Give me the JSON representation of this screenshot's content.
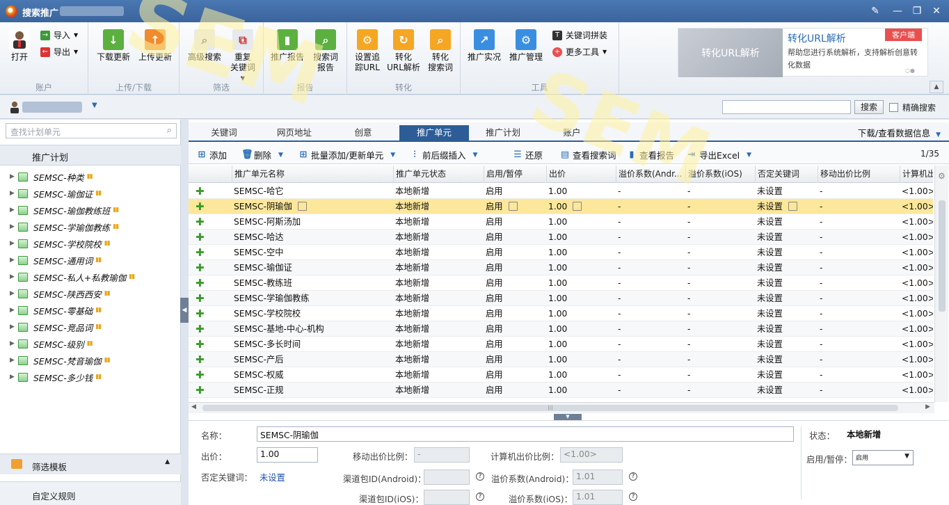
{
  "window": {
    "title": "搜索推广"
  },
  "ribbon": {
    "account_group": {
      "label": "账户",
      "open": "打开",
      "import": "导入",
      "export": "导出"
    },
    "transfer_group": {
      "label": "上传/下载",
      "download": "下载更新",
      "upload": "上传更新"
    },
    "filter_group": {
      "label": "筛选",
      "advanced": "高级搜索",
      "dup_line1": "重复",
      "dup_line2": "关键词"
    },
    "report_group": {
      "label": "报告",
      "promo_report": "推广报告",
      "sq_line1": "搜索词",
      "sq_line2": "报告"
    },
    "conv_group": {
      "label": "转化",
      "track_line1": "设置追",
      "track_line2": "踪URL",
      "url_line1": "转化",
      "url_line2": "URL解析",
      "sw_line1": "转化",
      "sw_line2": "搜索词"
    },
    "tool_group": {
      "label": "工具",
      "live": "推广实况",
      "manage": "推广管理",
      "kw_concat": "关键词拼装",
      "more": "更多工具"
    },
    "ad": {
      "image_text": "转化URL解析",
      "title": "转化URL解析",
      "desc": "帮助您进行系统解析，支持解析创意转化数据",
      "tag": "客户端"
    }
  },
  "topbar": {
    "search_button": "搜索",
    "exact": "精确搜索"
  },
  "left": {
    "search_placeholder": "查找计划单元",
    "header": "推广计划",
    "plans": [
      "SEMSC-种类",
      "SEMSC-瑜伽证",
      "SEMSC-瑜伽教练班",
      "SEMSC-学瑜伽教练",
      "SEMSC-学校院校",
      "SEMSC-通用词",
      "SEMSC-私人+私教瑜伽",
      "SEMSC-陕西西安",
      "SEMSC-零基础",
      "SEMSC-竞品词",
      "SEMSC-级别",
      "SEMSC-梵音瑜伽",
      "SEMSC-多少钱"
    ],
    "footer1": "筛选模板",
    "footer2": "自定义规则"
  },
  "tabs": [
    "关键词",
    "网页地址",
    "创意",
    "推广单元",
    "推广计划",
    "账户"
  ],
  "download_info": "下载/查看数据信息",
  "toolbar": {
    "add": "添加",
    "delete": "删除",
    "batch": "批量添加/更新单元",
    "insert": "前后缀插入",
    "restore": "还原",
    "view_sq": "查看搜索词",
    "view_report": "查看报告",
    "export": "导出Excel",
    "page": "1/35"
  },
  "grid": {
    "columns": [
      "推广单元名称",
      "推广单元状态",
      "启用/暂停",
      "出价",
      "溢价系数(Andr...",
      "溢价系数(iOS)",
      "否定关键词",
      "移动出价比例",
      "计算机出"
    ],
    "rows": [
      [
        "SEMSC-哈它",
        "本地新增",
        "启用",
        "1.00",
        "-",
        "-",
        "未设置",
        "-",
        "<1.00>"
      ],
      [
        "SEMSC-阴瑜伽",
        "本地新增",
        "启用",
        "1.00",
        "-",
        "-",
        "未设置",
        "-",
        "<1.00>"
      ],
      [
        "SEMSC-阿斯汤加",
        "本地新增",
        "启用",
        "1.00",
        "-",
        "-",
        "未设置",
        "-",
        "<1.00>"
      ],
      [
        "SEMSC-哈达",
        "本地新增",
        "启用",
        "1.00",
        "-",
        "-",
        "未设置",
        "-",
        "<1.00>"
      ],
      [
        "SEMSC-空中",
        "本地新增",
        "启用",
        "1.00",
        "-",
        "-",
        "未设置",
        "-",
        "<1.00>"
      ],
      [
        "SEMSC-瑜伽证",
        "本地新增",
        "启用",
        "1.00",
        "-",
        "-",
        "未设置",
        "-",
        "<1.00>"
      ],
      [
        "SEMSC-教练班",
        "本地新增",
        "启用",
        "1.00",
        "-",
        "-",
        "未设置",
        "-",
        "<1.00>"
      ],
      [
        "SEMSC-学瑜伽教练",
        "本地新增",
        "启用",
        "1.00",
        "-",
        "-",
        "未设置",
        "-",
        "<1.00>"
      ],
      [
        "SEMSC-学校院校",
        "本地新增",
        "启用",
        "1.00",
        "-",
        "-",
        "未设置",
        "-",
        "<1.00>"
      ],
      [
        "SEMSC-基地-中心-机构",
        "本地新增",
        "启用",
        "1.00",
        "-",
        "-",
        "未设置",
        "-",
        "<1.00>"
      ],
      [
        "SEMSC-多长时间",
        "本地新增",
        "启用",
        "1.00",
        "-",
        "-",
        "未设置",
        "-",
        "<1.00>"
      ],
      [
        "SEMSC-产后",
        "本地新增",
        "启用",
        "1.00",
        "-",
        "-",
        "未设置",
        "-",
        "<1.00>"
      ],
      [
        "SEMSC-权威",
        "本地新增",
        "启用",
        "1.00",
        "-",
        "-",
        "未设置",
        "-",
        "<1.00>"
      ],
      [
        "SEMSC-正规",
        "本地新增",
        "启用",
        "1.00",
        "-",
        "-",
        "未设置",
        "-",
        "<1.00>"
      ]
    ],
    "selected_index": 1
  },
  "detail": {
    "name_label": "名称：",
    "name_value": "SEMSC-阴瑜伽",
    "bid_label": "出价：",
    "bid_value": "1.00",
    "mobile_label": "移动出价比例：",
    "mobile_value": "-",
    "pc_label": "计算机出价比例：",
    "pc_value": "<1.00>",
    "neg_label": "否定关键词：",
    "neg_value": "未设置",
    "android_pkg_label": "渠道包ID(Android)：",
    "android_coef_label": "溢价系数(Android)：",
    "android_coef_value": "1.01",
    "ios_pkg_label": "渠道包ID(iOS)：",
    "ios_coef_label": "溢价系数(iOS)：",
    "ios_coef_value": "1.01",
    "status_label": "状态：",
    "status_value": "本地新增",
    "toggle_label": "启用/暂停：",
    "toggle_value": "启用"
  }
}
